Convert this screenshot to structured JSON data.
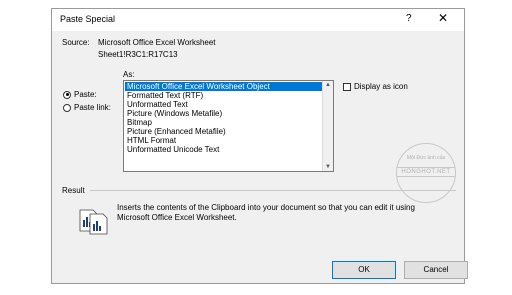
{
  "dialog": {
    "title": "Paste Special",
    "help": "?",
    "close": "✕"
  },
  "source": {
    "label": "Source:",
    "value": "Microsoft Office Excel Worksheet",
    "ref": "Sheet1!R3C1:R17C13"
  },
  "as_label": "As:",
  "options": {
    "paste": "Paste:",
    "paste_link": "Paste link:",
    "selected": "paste"
  },
  "list": {
    "items": [
      "Microsoft Office Excel Worksheet Object",
      "Formatted Text (RTF)",
      "Unformatted Text",
      "Picture (Windows Metafile)",
      "Bitmap",
      "Picture (Enhanced Metafile)",
      "HTML Format",
      "Unformatted Unicode Text"
    ],
    "selected_index": 0
  },
  "display_as_icon": {
    "label": "Display as icon",
    "checked": false
  },
  "watermark": {
    "line1": "Một Đức ảnh của",
    "line2": "HONGHOT.NET"
  },
  "result": {
    "label": "Result",
    "text": "Inserts the contents of the Clipboard into your document so that you can edit it using Microsoft Office Excel Worksheet.",
    "icon": "paste-result-icon"
  },
  "buttons": {
    "ok": "OK",
    "cancel": "Cancel"
  },
  "colors": {
    "selection": "#0078d7",
    "dialog_bg": "#f0f0f0"
  }
}
